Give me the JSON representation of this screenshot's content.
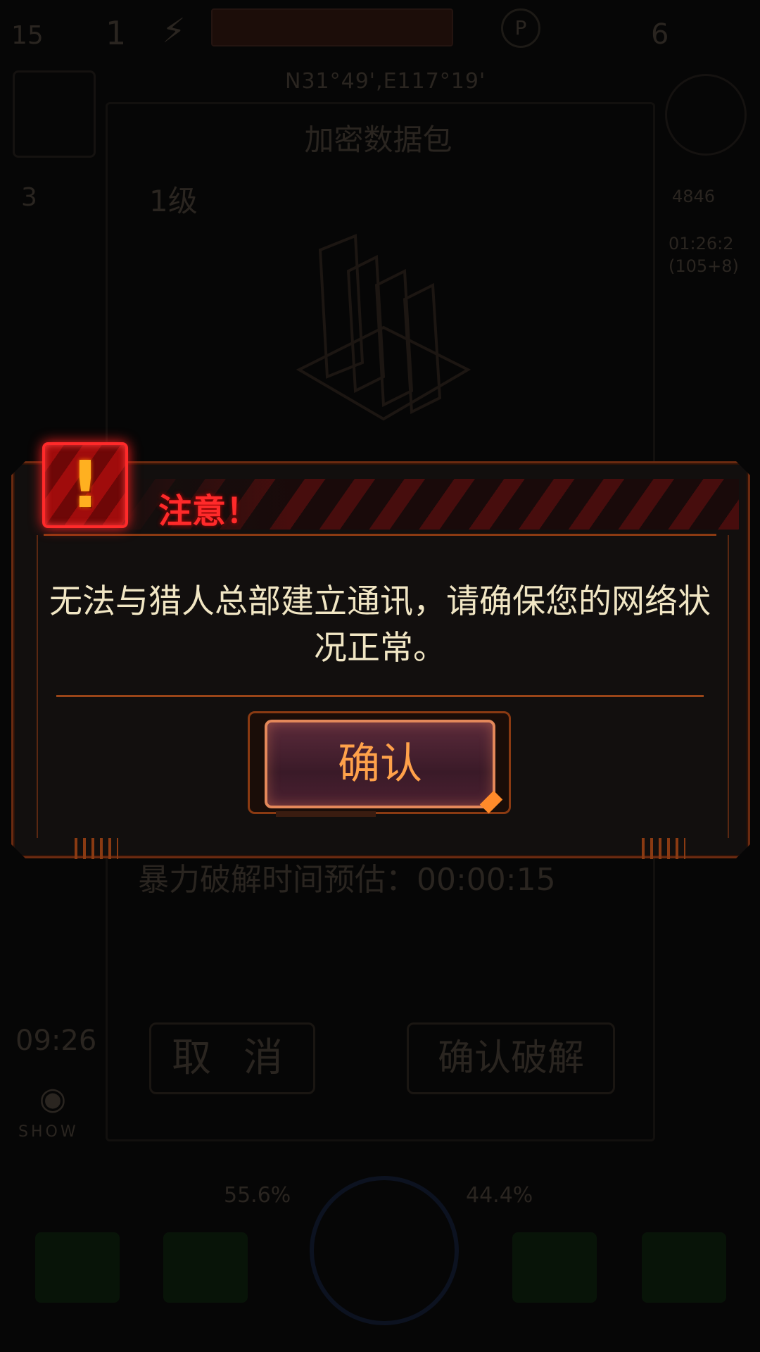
{
  "background": {
    "top_left_value": "15",
    "top_one": "1",
    "top_right_value": "6",
    "coordinates": "N31°49',E117°19'",
    "panel_title": "加密数据包",
    "level": "1级",
    "left_value": "3",
    "right_info_1": "4846",
    "right_info_2": "01:26:2\n(105+8)",
    "estimate_text": "暴力破解时间预估：00:00:15",
    "time_left": "09:26",
    "cancel_label": "取 消",
    "confirm_crack_label": "确认破解",
    "show_label": "SHOW",
    "pct_left": "55.6%",
    "pct_right": "44.4%"
  },
  "dialog": {
    "title": "注意！",
    "message": "无法与猎人总部建立通讯，请确保您的网络状况正常。",
    "ok_label": "确认"
  },
  "colors": {
    "warning_red": "#ff2a2a",
    "frame_orange": "#8a3a12",
    "button_text": "#ffa14a",
    "message_text": "#f1e6c4"
  },
  "icons": {
    "warning": "exclamation-icon",
    "eye": "eye-icon",
    "bolt": "bolt-icon"
  }
}
